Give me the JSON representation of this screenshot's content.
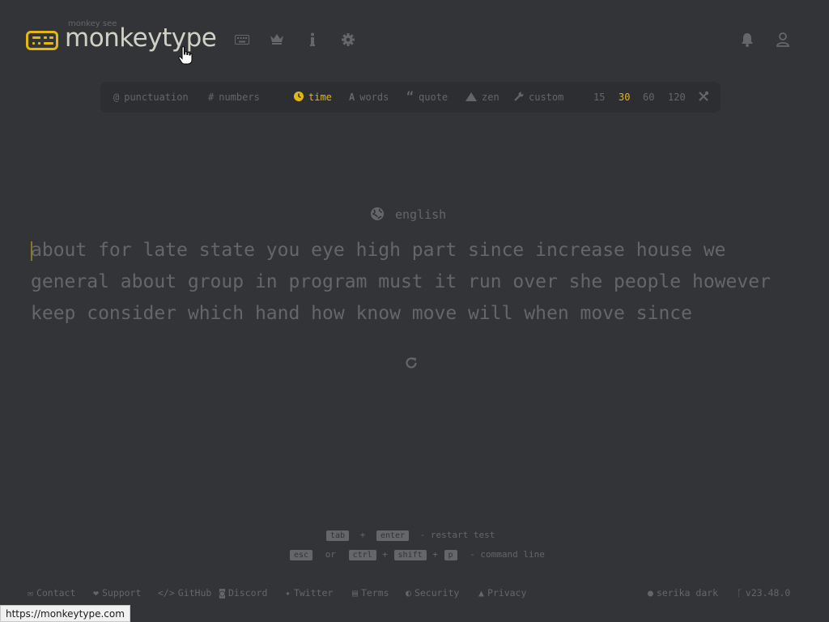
{
  "header": {
    "logo_sub": "monkey see",
    "logo_text": "monkeytype",
    "nav_icons": [
      "keyboard-icon",
      "crown-icon",
      "info-icon",
      "gear-icon"
    ],
    "right_icons": [
      "bell-icon",
      "user-icon"
    ]
  },
  "config": {
    "punctuation": "punctuation",
    "numbers": "numbers",
    "modes": [
      "time",
      "words",
      "quote",
      "zen",
      "custom"
    ],
    "active_mode": "time",
    "durations": [
      "15",
      "30",
      "60",
      "120"
    ],
    "active_duration": "30"
  },
  "test": {
    "language": "english",
    "lines": [
      "about for late state you eye high part since increase house we",
      "general about group in program must it run over she people however",
      "keep consider which hand how know move will when move since"
    ]
  },
  "hints": {
    "tab": "tab",
    "plus": "+",
    "enter": "enter",
    "restart_text": "- restart test",
    "esc": "esc",
    "or": "or",
    "ctrl": "ctrl",
    "shift": "shift",
    "p": "p",
    "command_text": "- command line"
  },
  "footer": {
    "links": [
      "Contact",
      "Support",
      "GitHub",
      "Discord",
      "Twitter",
      "Terms",
      "Security",
      "Privacy"
    ],
    "theme": "serika dark",
    "version": "v23.48.0"
  },
  "status_url": "https://monkeytype.com",
  "colors": {
    "background": "#323437",
    "sub_background": "#2c2e31",
    "main": "#e2b714",
    "sub": "#646669",
    "text": "#d1d0c5"
  }
}
